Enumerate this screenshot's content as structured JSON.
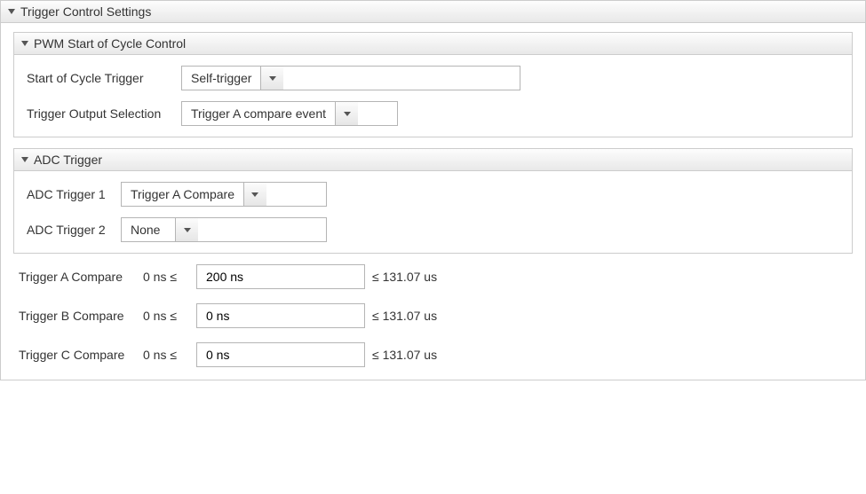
{
  "panel": {
    "title": "Trigger Control Settings"
  },
  "pwm": {
    "title": "PWM Start of Cycle Control",
    "soc_label": "Start of Cycle Trigger",
    "soc_value": "Self-trigger",
    "tos_label": "Trigger Output Selection",
    "tos_value": "Trigger A compare event"
  },
  "adc": {
    "title": "ADC Trigger",
    "t1_label": "ADC Trigger 1",
    "t1_value": "Trigger A Compare",
    "t2_label": "ADC Trigger 2",
    "t2_value": "None"
  },
  "compare": {
    "a": {
      "label": "Trigger A Compare",
      "min": "0 ns  ≤",
      "value": "200 ns",
      "max": "≤  131.07 us"
    },
    "b": {
      "label": "Trigger B Compare",
      "min": "0 ns  ≤",
      "value": "0 ns",
      "max": "≤  131.07 us"
    },
    "c": {
      "label": "Trigger C Compare",
      "min": "0 ns  ≤",
      "value": "0 ns",
      "max": "≤  131.07 us"
    }
  }
}
